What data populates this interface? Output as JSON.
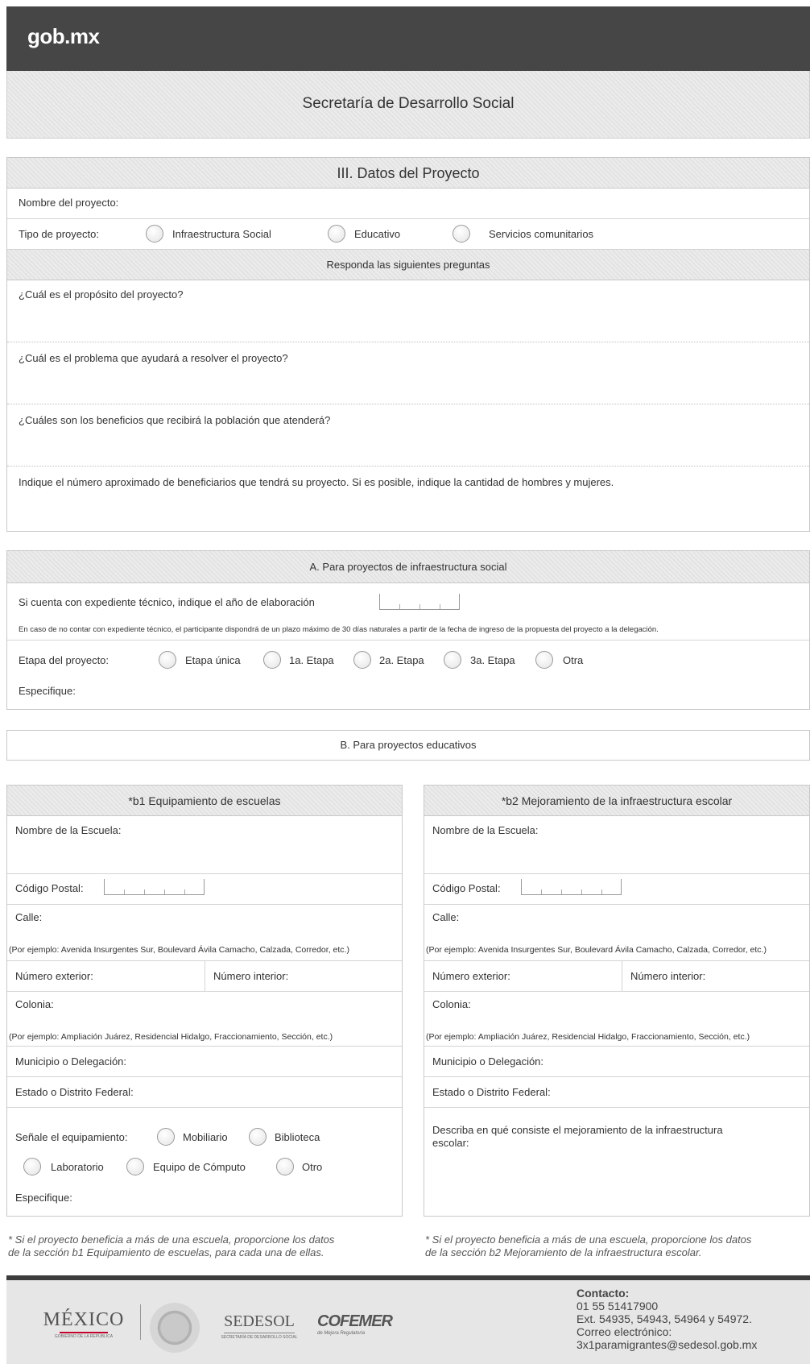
{
  "header": {
    "logo": "gob.mx",
    "subtitle": "Secretaría de Desarrollo Social"
  },
  "section3": {
    "title": "III. Datos del Proyecto",
    "nombre_label": "Nombre del proyecto:",
    "tipo_label": "Tipo de proyecto:",
    "tipo_options": [
      "Infraestructura Social",
      "Educativo",
      "Servicios comunitarios"
    ],
    "preguntas_header": "Responda las siguientes preguntas",
    "q1": "¿Cuál es el propósito del proyecto?",
    "q2": "¿Cuál es el problema que ayudará a resolver el proyecto?",
    "q3": "¿Cuáles son los beneficios que recibirá la población que atenderá?",
    "q4": "Indique el número aproximado de beneficiarios que tendrá su proyecto. Si es posible, indique la cantidad de hombres y mujeres."
  },
  "sectionA": {
    "title": "A. Para proyectos de infraestructura social",
    "expediente_label": "Si cuenta con expediente técnico, indique el año de elaboración",
    "nota": "En caso de no contar con expediente técnico, el participante dispondrá de un plazo máximo de 30 días naturales a partir de la fecha de ingreso de la propuesta del proyecto a la delegación.",
    "etapa_label": "Etapa del proyecto:",
    "etapa_options": [
      "Etapa única",
      "1a. Etapa",
      "2a. Etapa",
      "3a. Etapa",
      "Otra"
    ],
    "especifique": "Especifique:"
  },
  "sectionB": {
    "title": "B. Para proyectos educativos",
    "b1": {
      "title": "*b1 Equipamiento de escuelas",
      "nombre": "Nombre de la Escuela:",
      "cp": "Código Postal:",
      "calle": "Calle:",
      "calle_ej": "(Por ejemplo: Avenida Insurgentes Sur, Boulevard Ávila Camacho, Calzada, Corredor, etc.)",
      "num_ext": "Número exterior:",
      "num_int": "Número interior:",
      "colonia": "Colonia:",
      "colonia_ej": "(Por ejemplo: Ampliación Juárez, Residencial Hidalgo, Fraccionamiento, Sección, etc.)",
      "municipio": "Municipio o Delegación:",
      "estado": "Estado o Distrito Federal:",
      "equip_label": "Señale el equipamiento:",
      "equip_options": [
        "Mobiliario",
        "Biblioteca",
        "Laboratorio",
        "Equipo de Cómputo",
        "Otro"
      ],
      "especifique": "Especifique:",
      "nota_1": "* Si el proyecto beneficia a más de una escuela, proporcione los datos",
      "nota_2": "de la sección b1 Equipamiento de escuelas, para cada una de ellas."
    },
    "b2": {
      "title": "*b2 Mejoramiento de la infraestructura escolar",
      "nombre": "Nombre de la Escuela:",
      "cp": "Código Postal:",
      "calle": "Calle:",
      "calle_ej": "(Por ejemplo: Avenida Insurgentes Sur, Boulevard Ávila Camacho, Calzada, Corredor, etc.)",
      "num_ext": "Número exterior:",
      "num_int": "Número interior:",
      "colonia": "Colonia:",
      "colonia_ej": "(Por ejemplo: Ampliación Juárez, Residencial Hidalgo, Fraccionamiento, Sección, etc.)",
      "municipio": "Municipio o Delegación:",
      "estado": "Estado o Distrito Federal:",
      "describa_1": "Describa en qué consiste el mejoramiento de la infraestructura",
      "describa_2": "escolar:",
      "nota_1": "* Si el proyecto beneficia a más de una escuela, proporcione los datos",
      "nota_2": "de la sección b2 Mejoramiento de la infraestructura escolar."
    }
  },
  "footer": {
    "logo_mexico": "MÉXICO",
    "logo_mexico_sub": "GOBIERNO DE LA REPÚBLICA",
    "logo_sedesol": "SEDESOL",
    "logo_sedesol_sub": "SECRETARÍA DE DESARROLLO SOCIAL",
    "logo_cofemer": "COFEMER",
    "logo_cofemer_sub": "de Mejora Regulatoria",
    "contact_title": "Contacto:",
    "phone": "01 55 51417900",
    "ext": "Ext. 54935, 54943, 54964 y 54972.",
    "email_label": "Correo electrónico:",
    "email": "3x1paramigrantes@sedesol.gob.mx"
  }
}
